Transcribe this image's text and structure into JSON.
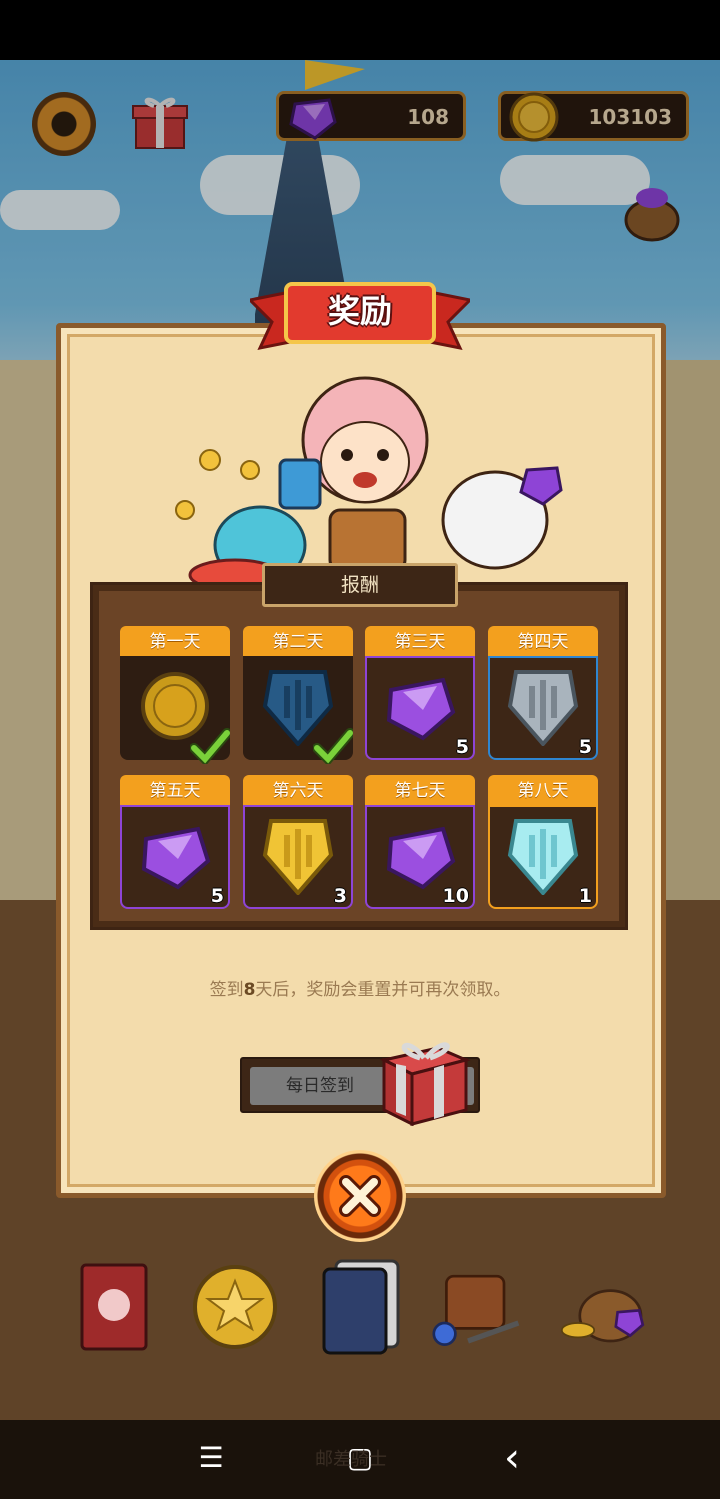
{
  "hud": {
    "settings_icon": "gear-icon",
    "gift_icon": "gift-box-icon",
    "gems": "108",
    "coins": "103103",
    "gem_color": "#8e44d6",
    "coin_color": "#d7a11c"
  },
  "dialog": {
    "title": "奖励",
    "board_title": "报酬",
    "days": [
      {
        "label": "第一天",
        "item": "gold-coin-icon",
        "qty": "",
        "claimed": true
      },
      {
        "label": "第二天",
        "item": "blue-shield-icon",
        "qty": "",
        "claimed": true
      },
      {
        "label": "第三天",
        "item": "purple-gem-icon",
        "qty": "5",
        "claimed": false
      },
      {
        "label": "第四天",
        "item": "silver-shield-icon",
        "qty": "5",
        "claimed": false
      },
      {
        "label": "第五天",
        "item": "purple-gem-icon",
        "qty": "5",
        "claimed": false
      },
      {
        "label": "第六天",
        "item": "gold-shield-icon",
        "qty": "3",
        "claimed": false
      },
      {
        "label": "第七天",
        "item": "purple-gem-icon",
        "qty": "10",
        "claimed": false
      },
      {
        "label": "第八天",
        "item": "diamond-shield-icon",
        "qty": "1",
        "claimed": false
      }
    ],
    "info_prefix": "签到",
    "info_days": "8",
    "info_suffix": "天后，奖励会重置并可再次领取。",
    "checkin_label": "每日签到",
    "close_icon": "close-icon"
  },
  "bottom_menu": [
    "book-icon",
    "star-coin-icon",
    "card-deck-icon",
    "adventure-gear-icon",
    "treasure-bag-icon"
  ],
  "navbar": {
    "menu": "☰",
    "home": "▢",
    "back": "‹"
  },
  "watermark": "邮差骑士"
}
